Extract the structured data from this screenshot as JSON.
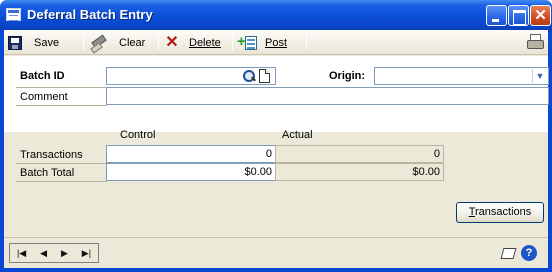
{
  "window": {
    "title": "Deferral Batch Entry"
  },
  "toolbar": {
    "save_label": "Save",
    "clear_label": "Clear",
    "delete_label": "Delete",
    "post_label": "Post"
  },
  "form": {
    "batch_id_label": "Batch ID",
    "batch_id_value": "",
    "origin_label": "Origin:",
    "origin_value": "",
    "comment_label": "Comment",
    "comment_value": ""
  },
  "totals": {
    "control_header": "Control",
    "actual_header": "Actual",
    "transactions_label": "Transactions",
    "transactions_control": "0",
    "transactions_actual": "0",
    "batch_total_label": "Batch Total",
    "batch_total_control": "$0.00",
    "batch_total_actual": "$0.00"
  },
  "buttons": {
    "transactions_label": "Transactions",
    "transactions_mnemonic": "T",
    "transactions_rest": "ransactions"
  },
  "nav": {
    "first": "|◀",
    "prev": "◀",
    "next": "▶",
    "last": "▶|"
  }
}
